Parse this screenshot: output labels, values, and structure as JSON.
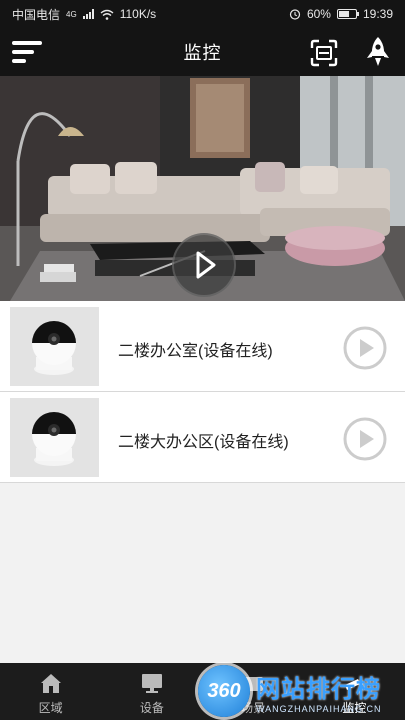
{
  "status_bar": {
    "carrier": "中国电信",
    "network_type": "4G",
    "speed": "110K/s",
    "battery_percent": "60%",
    "battery_level": 0.6,
    "time": "19:39"
  },
  "nav": {
    "title": "监控"
  },
  "hero": {
    "scene": "living-room-sofa-photo"
  },
  "devices": [
    {
      "name": "二楼办公室(设备在线)",
      "thumbnail": "dome-camera"
    },
    {
      "name": "二楼大办公区(设备在线)",
      "thumbnail": "dome-camera"
    }
  ],
  "tabs": [
    {
      "label": "区域",
      "icon": "home-icon",
      "active": false
    },
    {
      "label": "设备",
      "icon": "monitor-icon",
      "active": false
    },
    {
      "label": "场景",
      "icon": "scene-icon",
      "active": false
    },
    {
      "label": "监控",
      "icon": "camera-icon",
      "active": true
    }
  ],
  "watermark": {
    "logo_text": "360",
    "title": "网站排行榜",
    "subtitle": "WANGZHANPAIHANG.CN"
  },
  "colors": {
    "bar_background": "#141414",
    "tab_background": "#1c1c1c",
    "list_background": "#f2f2f2",
    "play_icon": "#cccccc"
  }
}
